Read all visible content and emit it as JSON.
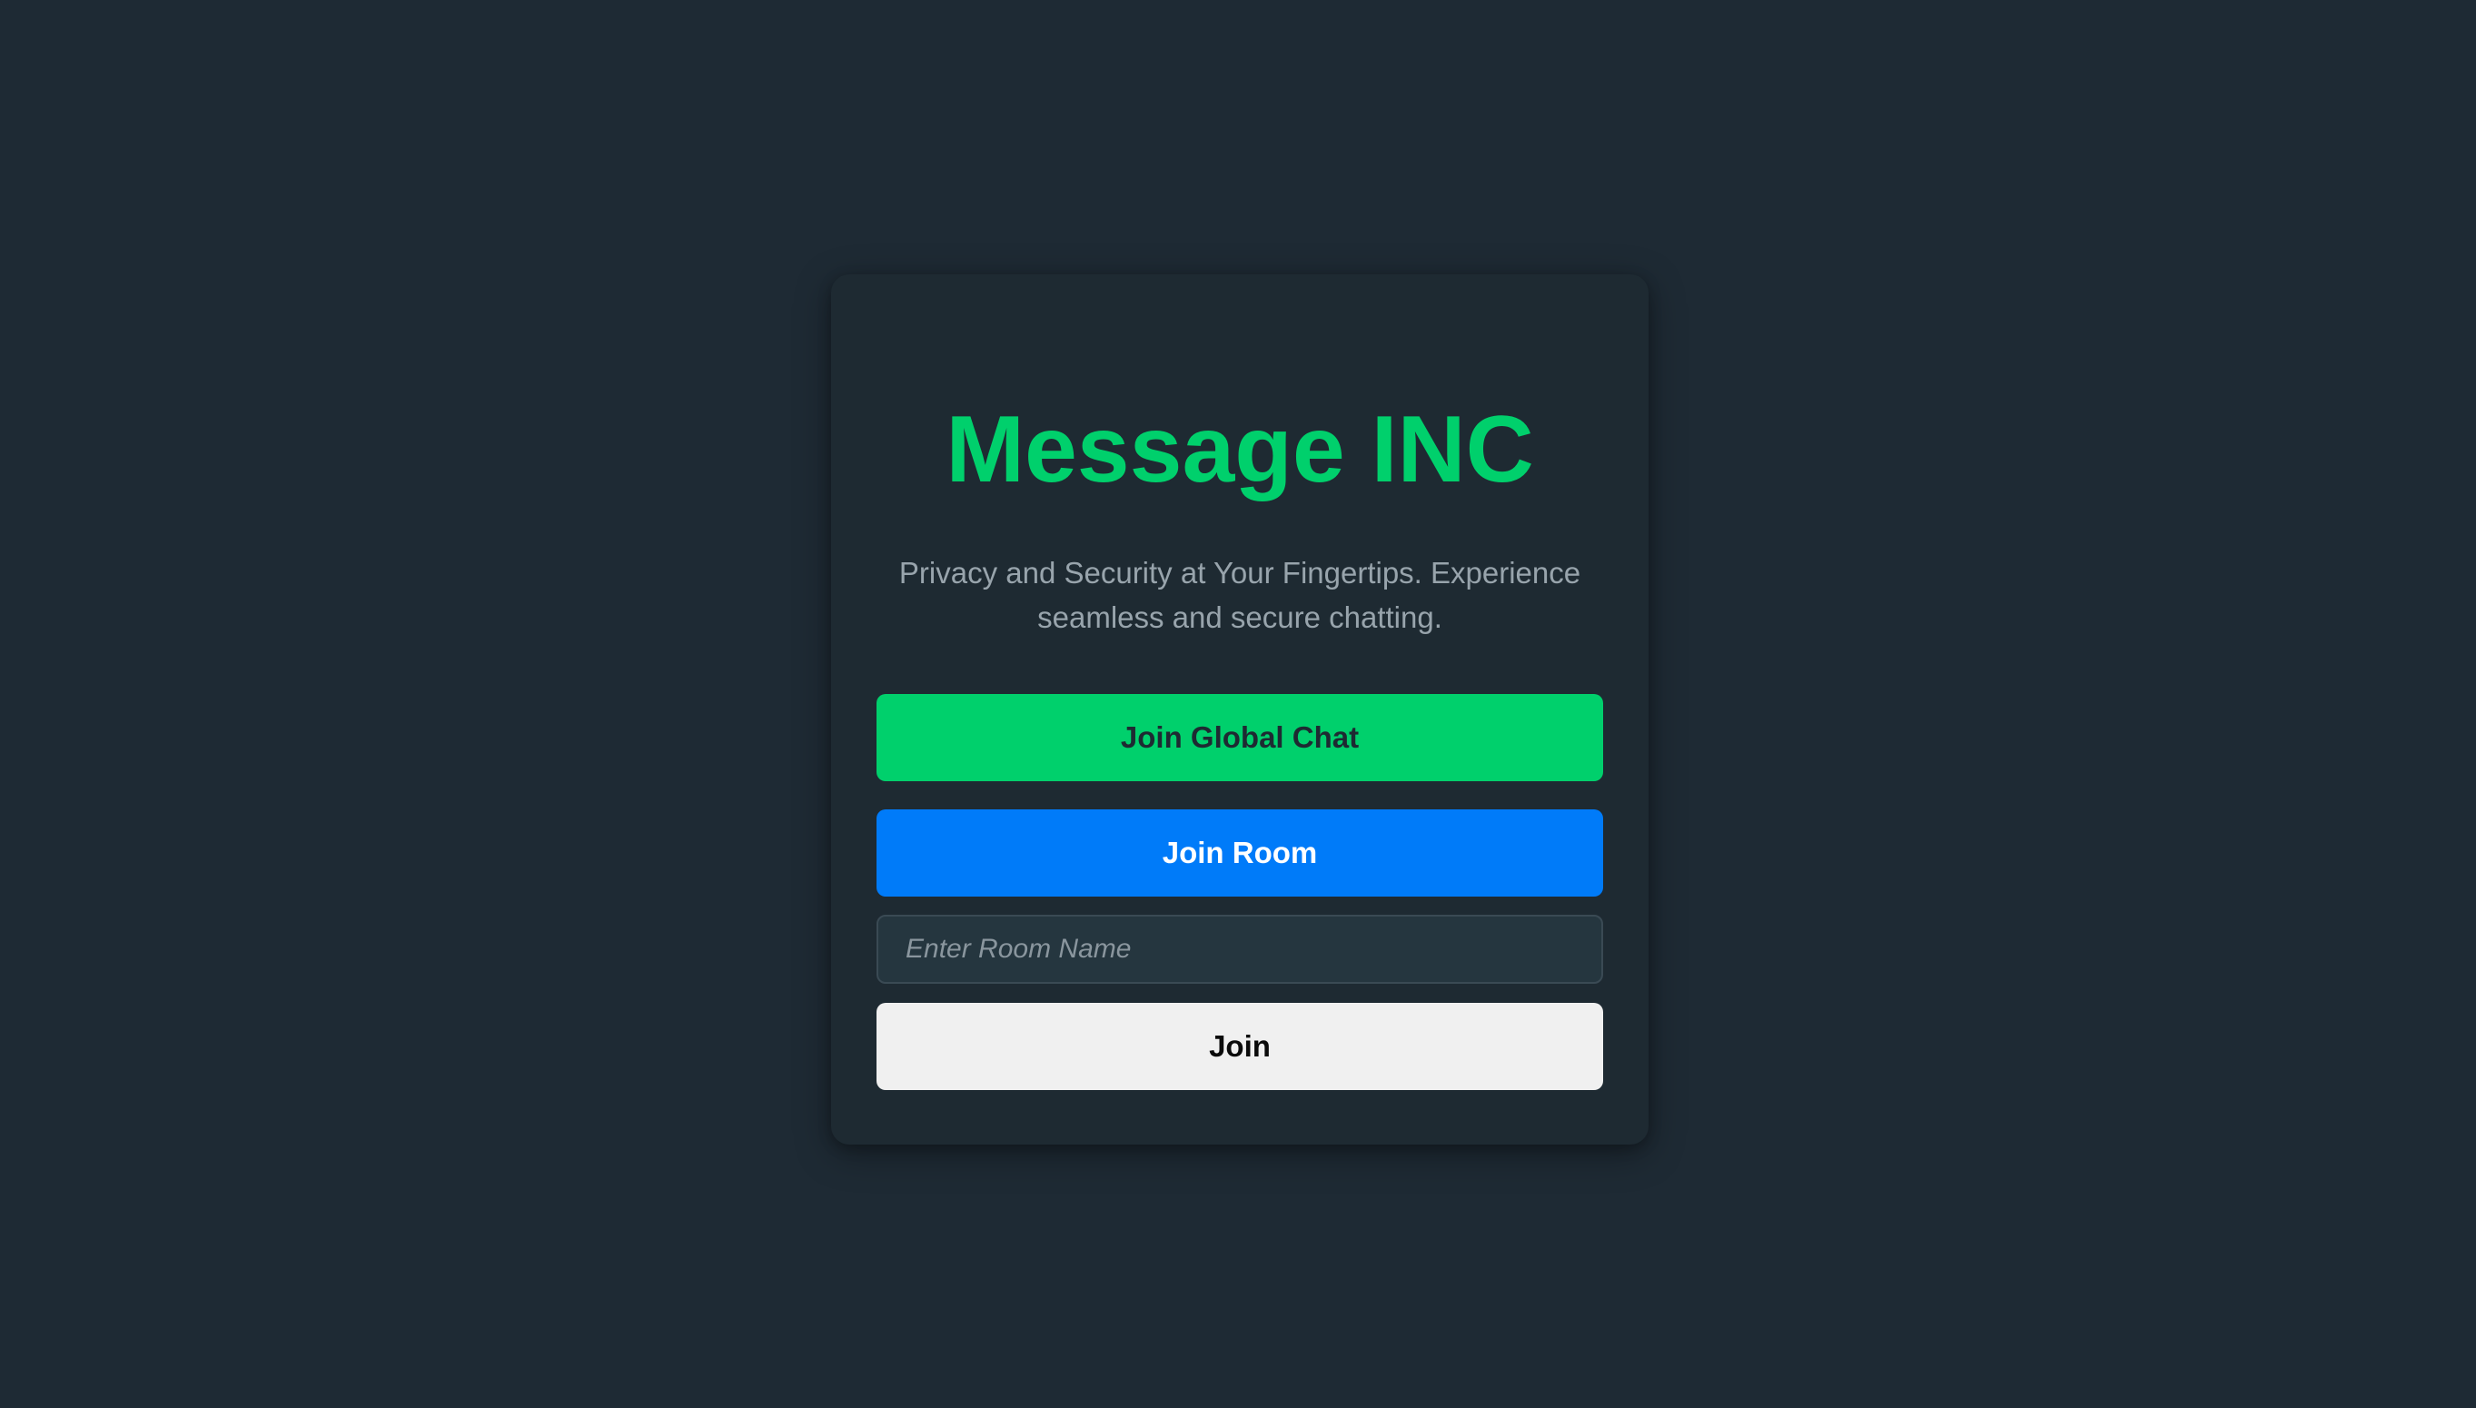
{
  "app": {
    "title": "Message INC",
    "tagline": "Privacy and Security at Your Fingertips. Experience seamless and secure chatting."
  },
  "actions": {
    "join_global_label": "Join Global Chat",
    "join_room_label": "Join Room",
    "join_label": "Join"
  },
  "room_input": {
    "value": "",
    "placeholder": "Enter Room Name"
  },
  "colors": {
    "background": "#1e2a34",
    "card": "#1e2a32",
    "accent_green": "#00d06c",
    "accent_blue": "#007bf9",
    "join_button": "#f0f0f0",
    "muted_text": "#98a4ac"
  }
}
